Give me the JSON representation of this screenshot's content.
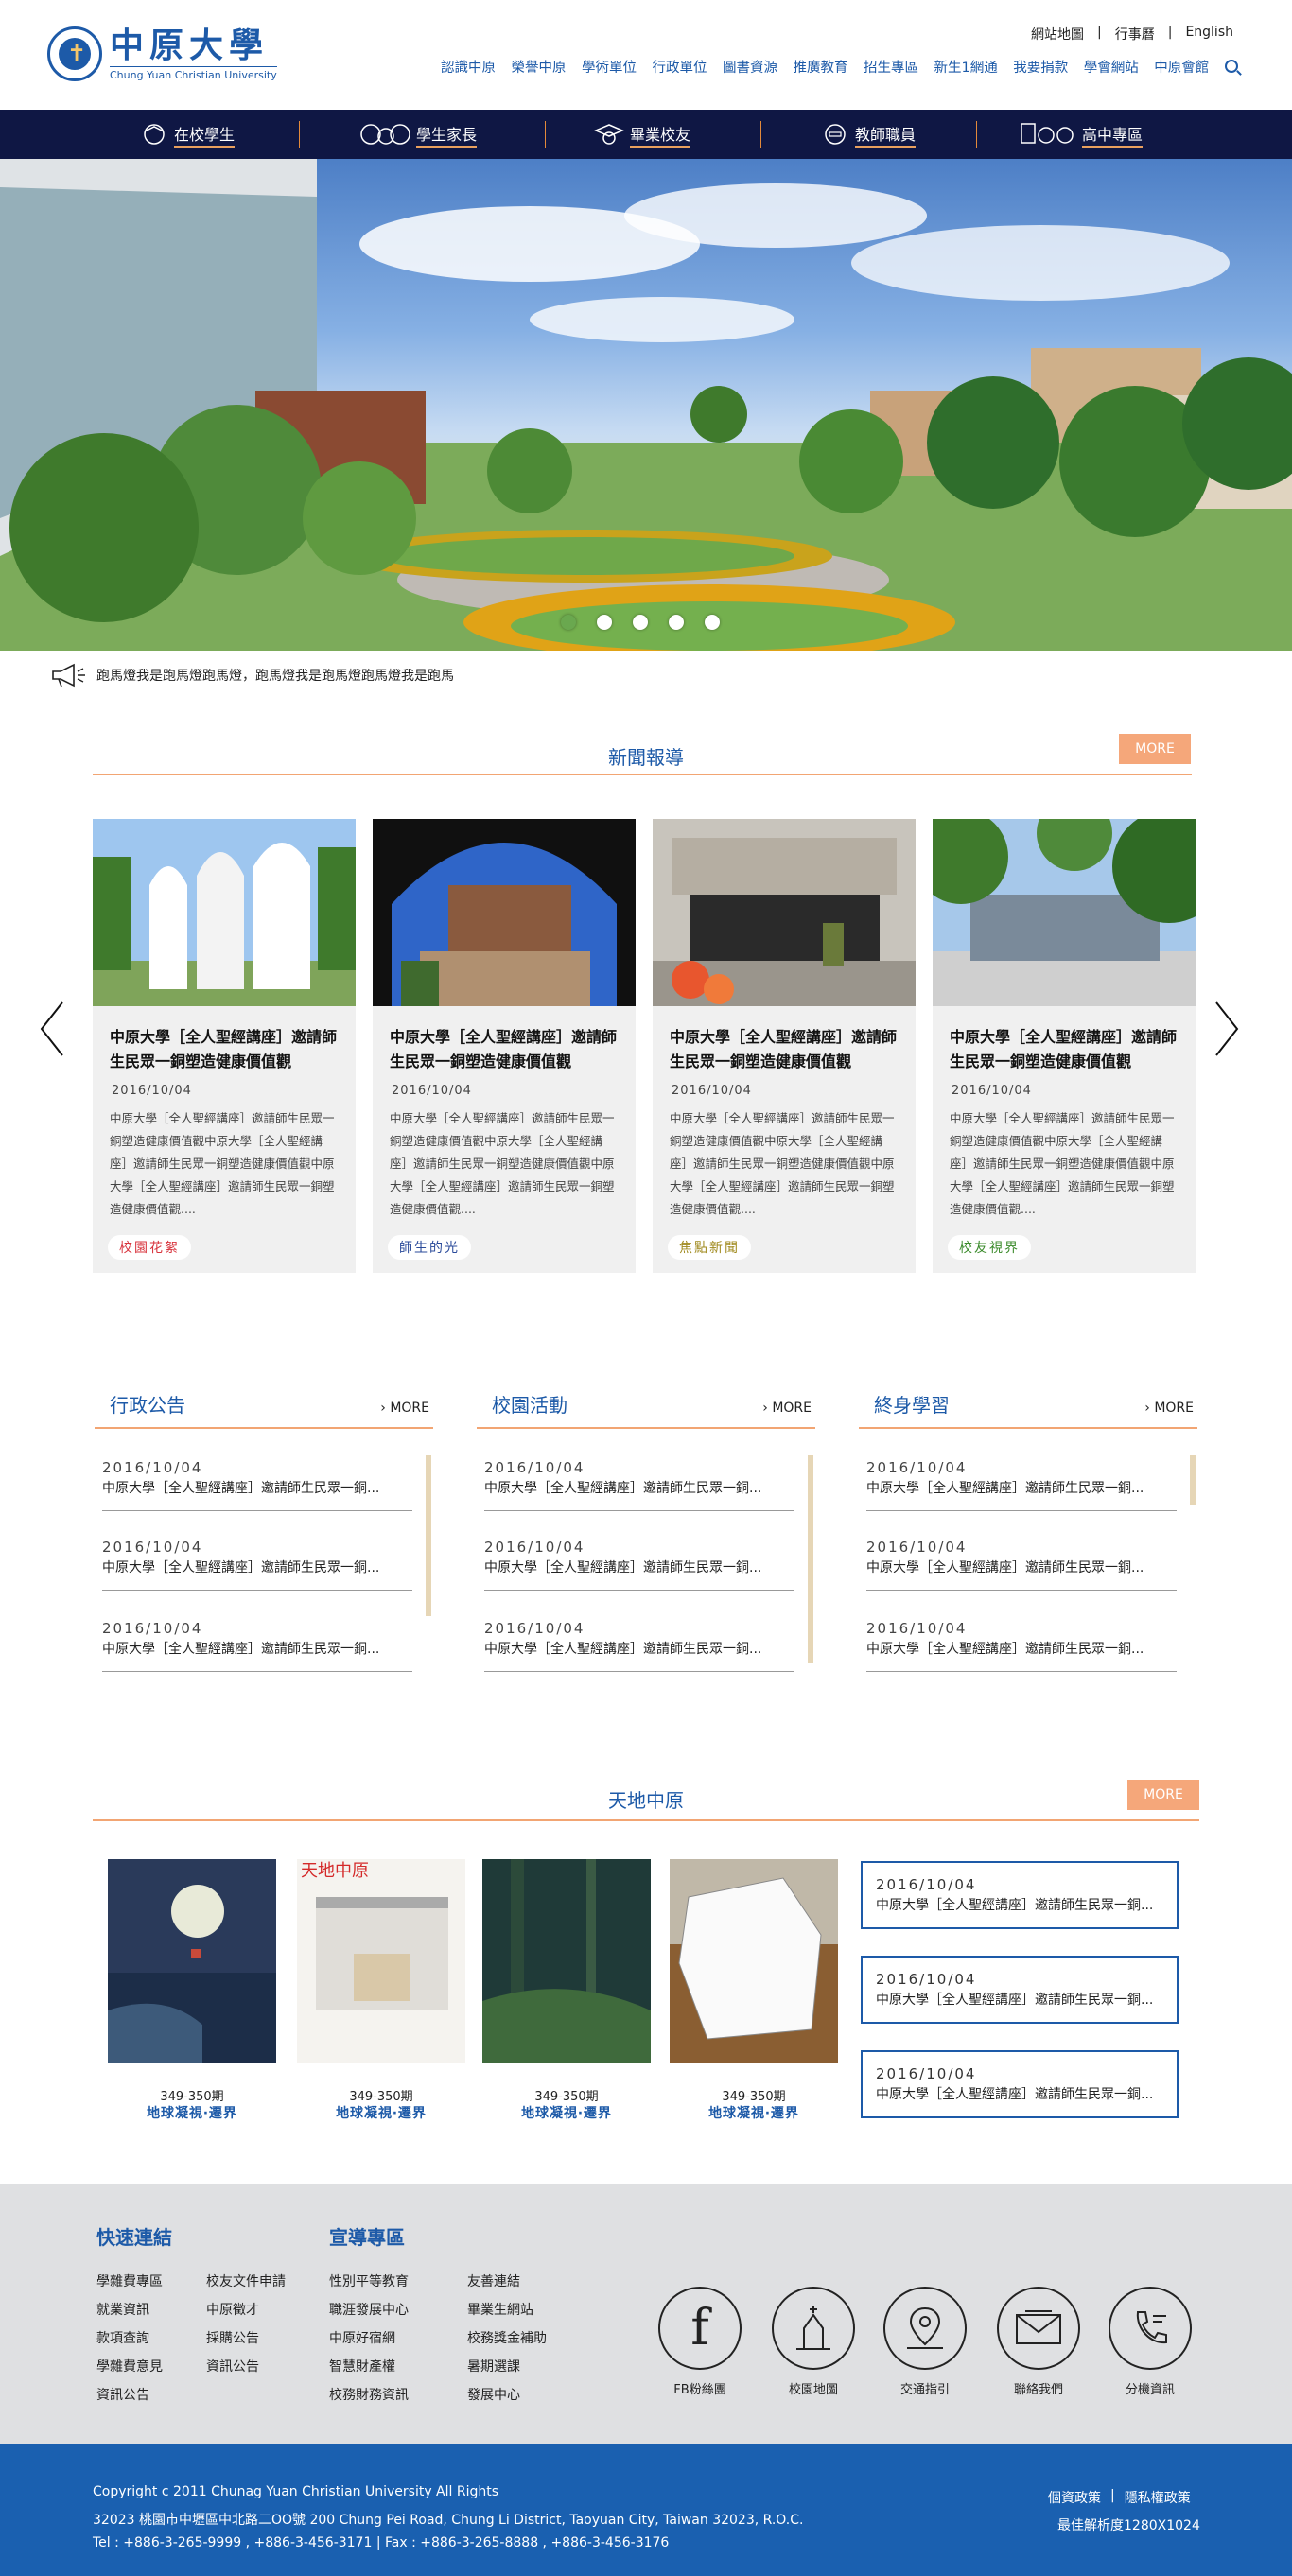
{
  "header": {
    "logo_cn": "中原大學",
    "logo_en": "Chung Yuan Christian University",
    "utility": [
      "網站地圖",
      "行事曆",
      "English"
    ],
    "nav": [
      "認識中原",
      "榮譽中原",
      "學術單位",
      "行政單位",
      "圖書資源",
      "推廣教育",
      "招生專區",
      "新生1網通",
      "我要捐款",
      "學會網站",
      "中原會館"
    ]
  },
  "rolebar": {
    "items": [
      "在校學生",
      "學生家長",
      "畢業校友",
      "教師職員",
      "高中專區"
    ]
  },
  "banner": {
    "slide_count": 5,
    "active_slide": 1
  },
  "ticker": {
    "text": "跑馬燈我是跑馬燈跑馬燈，跑馬燈我是跑馬燈跑馬燈我是跑馬"
  },
  "news": {
    "title": "新聞報導",
    "more": "MORE",
    "cards": [
      {
        "title": "中原大學［全人聖經講座］邀請師生民眾一銅塑造健康價值觀",
        "date": "2016/10/04",
        "text": "中原大學［全人聖經講座］邀請師生民眾一銅塑造健康價值觀中原大學［全人聖經講座］邀請師生民眾一銅塑造健康價值觀中原大學［全人聖經講座］邀請師生民眾一銅塑造健康價值觀....",
        "tag": "校園花絮",
        "tag_color": "#d8343d"
      },
      {
        "title": "中原大學［全人聖經講座］邀請師生民眾一銅塑造健康價值觀",
        "date": "2016/10/04",
        "text": "中原大學［全人聖經講座］邀請師生民眾一銅塑造健康價值觀中原大學［全人聖經講座］邀請師生民眾一銅塑造健康價值觀中原大學［全人聖經講座］邀請師生民眾一銅塑造健康價值觀....",
        "tag": "師生的光",
        "tag_color": "#2a4a9a"
      },
      {
        "title": "中原大學［全人聖經講座］邀請師生民眾一銅塑造健康價值觀",
        "date": "2016/10/04",
        "text": "中原大學［全人聖經講座］邀請師生民眾一銅塑造健康價值觀中原大學［全人聖經講座］邀請師生民眾一銅塑造健康價值觀中原大學［全人聖經講座］邀請師生民眾一銅塑造健康價值觀....",
        "tag": "焦點新聞",
        "tag_color": "#a08a1e"
      },
      {
        "title": "中原大學［全人聖經講座］邀請師生民眾一銅塑造健康價值觀",
        "date": "2016/10/04",
        "text": "中原大學［全人聖經講座］邀請師生民眾一銅塑造健康價值觀中原大學［全人聖經講座］邀請師生民眾一銅塑造健康價值觀中原大學［全人聖經講座］邀請師生民眾一銅塑造健康價值觀....",
        "tag": "校友視界",
        "tag_color": "#3a8a2a"
      }
    ]
  },
  "lists": [
    {
      "title": "行政公告",
      "more": "MORE",
      "items": [
        {
          "date": "2016/10/04",
          "text": "中原大學［全人聖經講座］邀請師生民眾一銅..."
        },
        {
          "date": "2016/10/04",
          "text": "中原大學［全人聖經講座］邀請師生民眾一銅..."
        },
        {
          "date": "2016/10/04",
          "text": "中原大學［全人聖經講座］邀請師生民眾一銅..."
        }
      ]
    },
    {
      "title": "校園活動",
      "more": "MORE",
      "items": [
        {
          "date": "2016/10/04",
          "text": "中原大學［全人聖經講座］邀請師生民眾一銅..."
        },
        {
          "date": "2016/10/04",
          "text": "中原大學［全人聖經講座］邀請師生民眾一銅..."
        },
        {
          "date": "2016/10/04",
          "text": "中原大學［全人聖經講座］邀請師生民眾一銅..."
        }
      ]
    },
    {
      "title": "終身學習",
      "more": "MORE",
      "items": [
        {
          "date": "2016/10/04",
          "text": "中原大學［全人聖經講座］邀請師生民眾一銅..."
        },
        {
          "date": "2016/10/04",
          "text": "中原大學［全人聖經講座］邀請師生民眾一銅..."
        },
        {
          "date": "2016/10/04",
          "text": "中原大學［全人聖經講座］邀請師生民眾一銅..."
        }
      ]
    }
  ],
  "magazine": {
    "title": "天地中原",
    "more": "MORE",
    "issues": [
      {
        "no": "349-350期",
        "title": "地球凝視‧遷界"
      },
      {
        "no": "349-350期",
        "title": "地球凝視‧遷界"
      },
      {
        "no": "349-350期",
        "title": "地球凝視‧遷界"
      },
      {
        "no": "349-350期",
        "title": "地球凝視‧遷界"
      }
    ],
    "text_items": [
      {
        "date": "2016/10/04",
        "text": "中原大學［全人聖經講座］邀請師生民眾一銅..."
      },
      {
        "date": "2016/10/04",
        "text": "中原大學［全人聖經講座］邀請師生民眾一銅..."
      },
      {
        "date": "2016/10/04",
        "text": "中原大學［全人聖經講座］邀請師生民眾一銅..."
      }
    ]
  },
  "footer": {
    "quick_title": "快速連結",
    "quick_col1": [
      "學雜費專區",
      "就業資訊",
      "款項查詢",
      "學雜費意見",
      "資訊公告"
    ],
    "quick_col2": [
      "校友文件申請",
      "中原徵才",
      "採購公告",
      "資訊公告"
    ],
    "promo_title": "宣導專區",
    "promo_col1": [
      "性別平等教育",
      "職涯發展中心",
      "中原好宿網",
      "智慧財產權",
      "校務財務資訊"
    ],
    "promo_col2": [
      "友善連結",
      "畢業生網站",
      "校務獎金補助",
      "暑期選課",
      "發展中心"
    ],
    "icons": [
      "FB粉絲團",
      "校園地圖",
      "交通指引",
      "聯絡我們",
      "分機資訊"
    ],
    "copyright": "Copyright c 2011 Chunag Yuan Christian University All Rights",
    "address": "32023 桃園市中壢區中北路二OO號 200 Chung Pei Road, Chung Li District, Taoyuan City, Taiwan 32023, R.O.C.",
    "tel": "Tel : +886-3-265-9999 , +886-3-456-3171 | Fax : +886-3-265-8888 , +886-3-456-3176",
    "privacy": "個資政策",
    "privacy2": "隱私權政策",
    "resolution": "最佳解析度1280X1024"
  }
}
